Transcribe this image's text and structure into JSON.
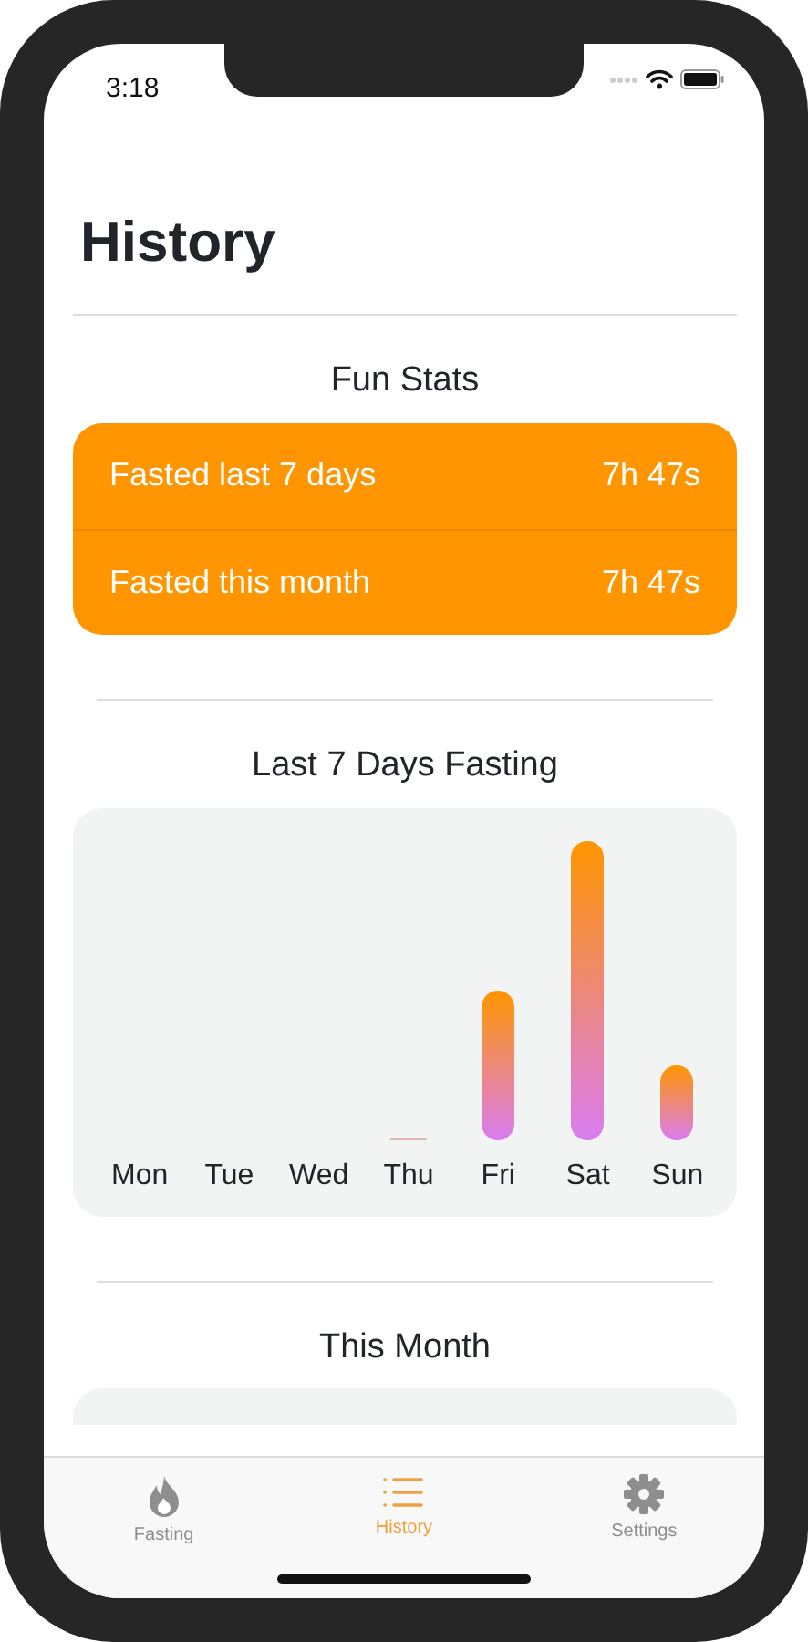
{
  "status_bar": {
    "time": "3:18"
  },
  "title": "History",
  "fun_stats": {
    "heading": "Fun Stats",
    "rows": [
      {
        "label": "Fasted last 7 days",
        "value": "7h 47s"
      },
      {
        "label": "Fasted this month",
        "value": "7h 47s"
      }
    ]
  },
  "weekly": {
    "heading": "Last 7 Days Fasting",
    "days": [
      {
        "label": "Mon"
      },
      {
        "label": "Tue"
      },
      {
        "label": "Wed"
      },
      {
        "label": "Thu"
      },
      {
        "label": "Fri"
      },
      {
        "label": "Sat"
      },
      {
        "label": "Sun"
      }
    ]
  },
  "month": {
    "heading": "This Month"
  },
  "tab_bar": [
    {
      "label": "Fasting",
      "selected": false
    },
    {
      "label": "History",
      "selected": true
    },
    {
      "label": "Settings",
      "selected": false
    }
  ]
}
